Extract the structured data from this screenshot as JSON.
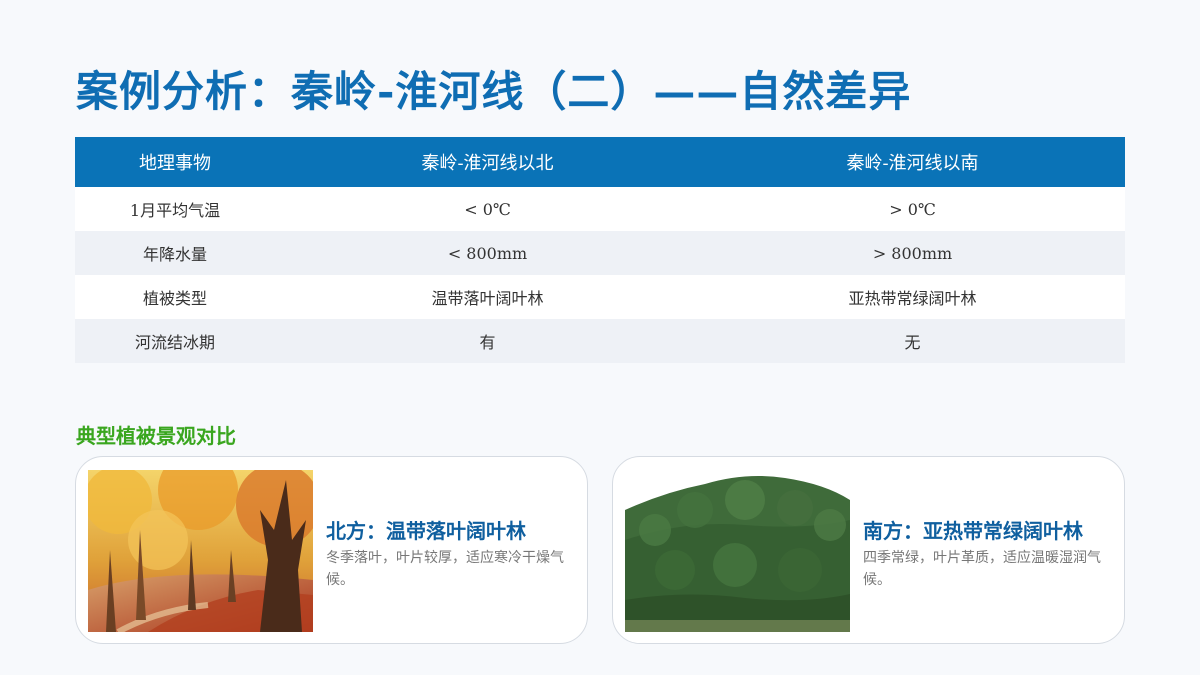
{
  "page": {
    "title": "案例分析：秦岭-淮河线（二）——自然差异"
  },
  "table": {
    "headers": [
      "地理事物",
      "秦岭-淮河线以北",
      "秦岭-淮河线以南"
    ],
    "rows": [
      [
        "1月平均气温",
        "< 0℃",
        "> 0℃"
      ],
      [
        "年降水量",
        "< 800mm",
        "> 800mm"
      ],
      [
        "植被类型",
        "温带落叶阔叶林",
        "亚热带常绿阔叶林"
      ],
      [
        "河流结冰期",
        "有",
        "无"
      ]
    ]
  },
  "section": {
    "title": "典型植被景观对比"
  },
  "cards": {
    "north": {
      "title": "北方：温带落叶阔叶林",
      "desc": "冬季落叶，叶片较厚，适应寒冷干燥气候。"
    },
    "south": {
      "title": "南方：亚热带常绿阔叶林",
      "desc": "四季常绿，叶片革质，适应温暖湿润气候。"
    }
  },
  "colors": {
    "title": "#0f6db3",
    "header_bg": "#0a73b7",
    "section_title": "#3aa61f",
    "card_title": "#0f5f9f"
  }
}
